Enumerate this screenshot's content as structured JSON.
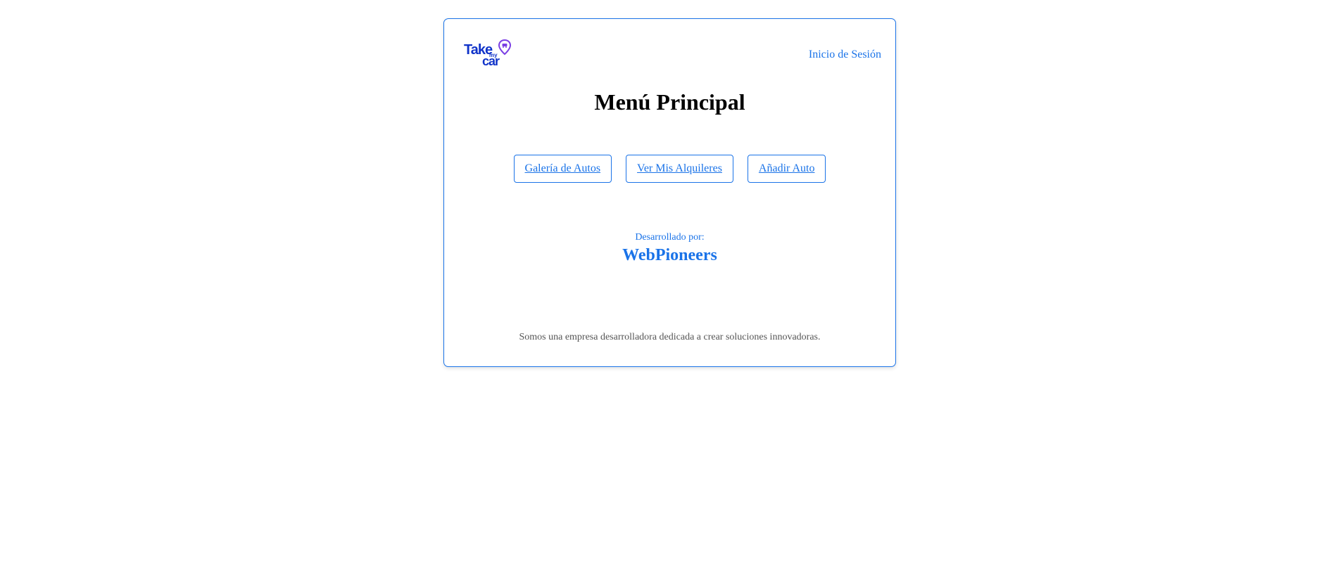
{
  "brand": {
    "logo_word_1": "Take",
    "logo_word_2": "my",
    "logo_word_3": "car",
    "logo_color": "#1033c9",
    "pin_color": "#7b3fe4"
  },
  "header": {
    "login_label": "Inicio de Sesión"
  },
  "main": {
    "title": "Menú Principal",
    "nav_buttons": [
      {
        "label": "Galería de Autos"
      },
      {
        "label": "Ver Mis Alquileres"
      },
      {
        "label": "Añadir Auto"
      }
    ]
  },
  "credits": {
    "label": "Desarrollado por:",
    "team": "WebPioneers"
  },
  "footer": {
    "text": "Somos una empresa desarrolladora dedicada a crear soluciones innovadoras."
  },
  "colors": {
    "accent": "#1a73e8",
    "text": "#000000",
    "muted": "#555555"
  }
}
